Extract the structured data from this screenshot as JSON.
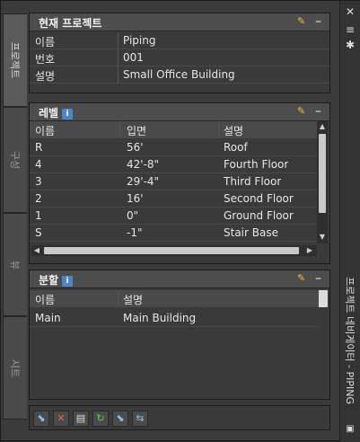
{
  "tabs": {
    "project": "프로젝트",
    "structure": "구성",
    "view": "뷰",
    "sheet": "시트"
  },
  "sidebar_title": "프로젝트 네비게이터 - PIPING",
  "current_project": {
    "title": "현재 프로젝트",
    "rows": [
      {
        "label": "이름",
        "value": "Piping"
      },
      {
        "label": "번호",
        "value": "001"
      },
      {
        "label": "설명",
        "value": "Small Office Building"
      }
    ]
  },
  "levels": {
    "title": "레벨",
    "info_icon": "i",
    "headers": {
      "name": "이름",
      "elevation": "입면",
      "description": "설명"
    },
    "rows": [
      {
        "name": "R",
        "elevation": "56'",
        "description": "Roof"
      },
      {
        "name": "4",
        "elevation": "42'-8\"",
        "description": "Fourth Floor"
      },
      {
        "name": "3",
        "elevation": "29'-4\"",
        "description": "Third Floor"
      },
      {
        "name": "2",
        "elevation": "16'",
        "description": "Second Floor"
      },
      {
        "name": "1",
        "elevation": "0\"",
        "description": "Ground Floor"
      },
      {
        "name": "S",
        "elevation": "-1\"",
        "description": "Stair Base"
      }
    ]
  },
  "divisions": {
    "title": "분할",
    "info_icon": "i",
    "headers": {
      "name": "이름",
      "description": "설명"
    },
    "rows": [
      {
        "name": "Main",
        "description": "Main Building"
      }
    ]
  },
  "icons": {
    "close": "close-icon",
    "pin": "pin-icon",
    "settings": "gear-icon"
  }
}
